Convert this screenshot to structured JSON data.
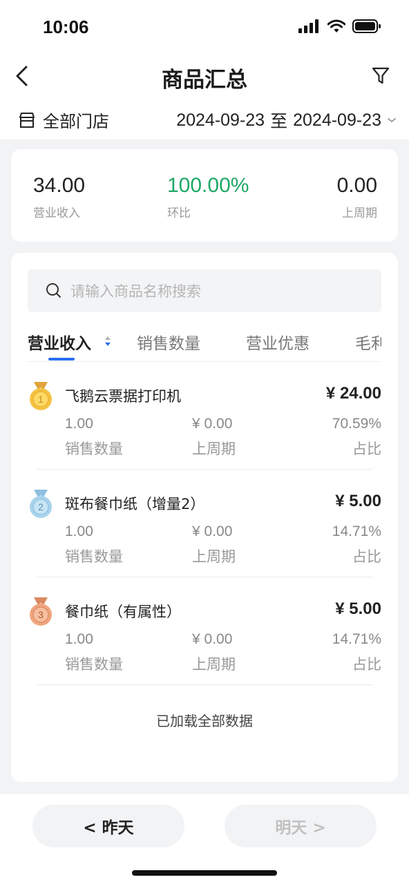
{
  "status_bar": {
    "time": "10:06"
  },
  "nav": {
    "title": "商品汇总"
  },
  "filters": {
    "store_label": "全部门店",
    "date_start": "2024-09-23",
    "date_sep": "至",
    "date_end": "2024-09-23"
  },
  "summary": {
    "revenue": {
      "value": "34.00",
      "label": "营业收入"
    },
    "ratio": {
      "value": "100.00%",
      "label": "环比"
    },
    "last_week": {
      "value": "0.00",
      "label": "上周期"
    }
  },
  "search": {
    "placeholder": "请输入商品名称搜索"
  },
  "tabs": [
    "营业收入",
    "销售数量",
    "营业优惠",
    "毛利"
  ],
  "items": [
    {
      "rank": "1",
      "name": "飞鹅云票据打印机",
      "amount": "¥ 24.00",
      "qty": "1.00",
      "qty_label": "销售数量",
      "last": "¥ 0.00",
      "last_label": "上周期",
      "share": "70.59%",
      "share_label": "占比",
      "medal_color": "#f5c242",
      "ribbon_color": "#e0a43c"
    },
    {
      "rank": "2",
      "name": "斑布餐巾纸（增量2）",
      "amount": "¥ 5.00",
      "qty": "1.00",
      "qty_label": "销售数量",
      "last": "¥ 0.00",
      "last_label": "上周期",
      "share": "14.71%",
      "share_label": "占比",
      "medal_color": "#a9d3ec",
      "ribbon_color": "#8ec0e0"
    },
    {
      "rank": "3",
      "name": "餐巾纸（有属性）",
      "amount": "¥ 5.00",
      "qty": "1.00",
      "qty_label": "销售数量",
      "last": "¥ 0.00",
      "last_label": "上周期",
      "share": "14.71%",
      "share_label": "占比",
      "medal_color": "#efa57f",
      "ribbon_color": "#d98a62"
    }
  ],
  "list_footer": "已加载全部数据",
  "bottom": {
    "prev_label": "<  昨天",
    "next_label": "明天  >"
  },
  "colors": {
    "accent": "#2b6ef0",
    "positive": "#1fa866"
  }
}
